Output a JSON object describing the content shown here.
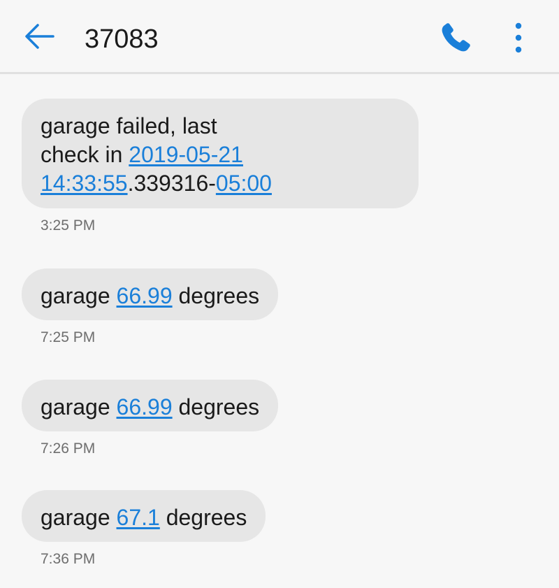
{
  "header": {
    "title": "37083",
    "back_icon": "arrow-left-icon",
    "call_icon": "phone-icon",
    "more_icon": "more-vertical-icon",
    "accent": "#1a7fd9"
  },
  "messages": [
    {
      "parts": [
        "garage failed, last",
        "check in ",
        "2019-05-21",
        "14:33:55",
        ".339316-",
        "05:00"
      ],
      "time": "3:25 PM"
    },
    {
      "parts": [
        "garage ",
        "66.99",
        " degrees"
      ],
      "time": "7:25 PM"
    },
    {
      "parts": [
        "garage ",
        "66.99",
        " degrees"
      ],
      "time": "7:26 PM"
    },
    {
      "parts": [
        "garage ",
        "67.1",
        " degrees"
      ],
      "time": "7:36 PM"
    }
  ]
}
